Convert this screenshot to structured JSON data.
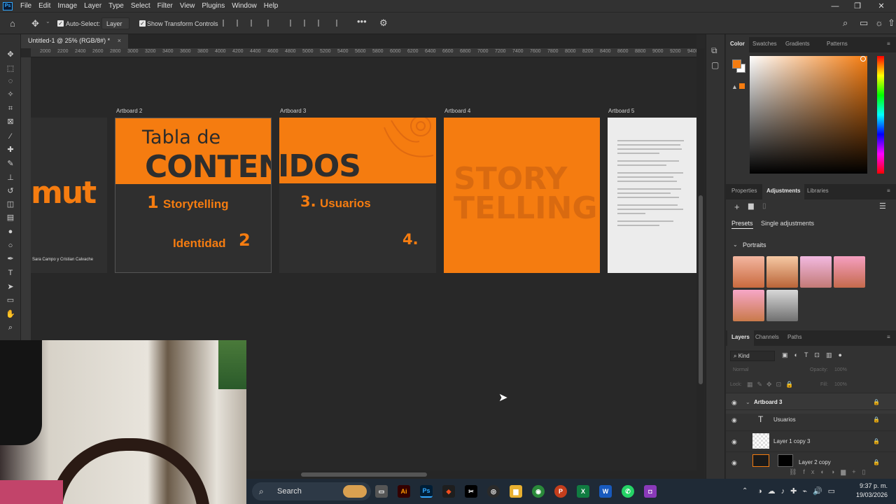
{
  "menubar": {
    "items": [
      "File",
      "Edit",
      "Image",
      "Layer",
      "Type",
      "Select",
      "Filter",
      "View",
      "Plugins",
      "Window",
      "Help"
    ]
  },
  "options": {
    "auto_select_label": "Auto-Select:",
    "layer_select": "Layer",
    "show_transform_label": "Show Transform Controls"
  },
  "document": {
    "tab_title": "Untitled-1 @ 25% (RGB/8#) *"
  },
  "ruler": {
    "ticks": [
      "2000",
      "2200",
      "2400",
      "2600",
      "2800",
      "3000",
      "3200",
      "3400",
      "3600",
      "3800",
      "4000",
      "4200",
      "4400",
      "4600",
      "4800",
      "5000",
      "5200",
      "5400",
      "5600",
      "5800",
      "6000",
      "6200",
      "6400",
      "6600",
      "6800",
      "7000",
      "7200",
      "7400",
      "7600",
      "7800",
      "8000",
      "8200",
      "8400",
      "8600",
      "8800",
      "9000",
      "9200",
      "9400"
    ]
  },
  "artboards": {
    "a2_label": "Artboard 2",
    "a3_label": "Artboard 3",
    "a4_label": "Artboard 4",
    "a5_label": "Artboard 5",
    "a1_word": "mut",
    "a1_credit": "Sara Campo y Cristian Calvache",
    "tabla_de": "Tabla de",
    "contenidos_a": "CONTEN",
    "contenidos_b": "IDOS",
    "storytelling": "Storytelling",
    "num1": "1",
    "identidad": "Identidad",
    "num2": "2",
    "usuarios": "Usuarios",
    "num3": "3.",
    "num4": "4.",
    "story": "STORY",
    "telling": "TELLING"
  },
  "panels": {
    "color_tabs": [
      "Color",
      "Swatches",
      "Gradients",
      "Patterns"
    ],
    "adj_tabs": [
      "Properties",
      "Adjustments",
      "Libraries"
    ],
    "presets_label": "Presets",
    "single_adj_label": "Single adjustments",
    "portraits_label": "Portraits",
    "layers_tabs": [
      "Layers",
      "Channels",
      "Paths"
    ],
    "kind_label": "Kind",
    "blend_mode": "Normal",
    "opacity_label": "Opacity:",
    "opacity_value": "100%",
    "lock_label": "Lock:",
    "fill_label": "Fill:",
    "fill_value": "100%",
    "layers": [
      {
        "name": "Artboard 3"
      },
      {
        "name": "Usuarios"
      },
      {
        "name": "Layer 1 copy 3"
      },
      {
        "name": "Layer 2 copy"
      }
    ]
  },
  "taskbar": {
    "search_label": "Search",
    "time": "9:37 p. m.",
    "date": "19/03/2026"
  },
  "colors": {
    "accent_orange": "#f57c10",
    "foreground_swatch": "#f57c10"
  }
}
